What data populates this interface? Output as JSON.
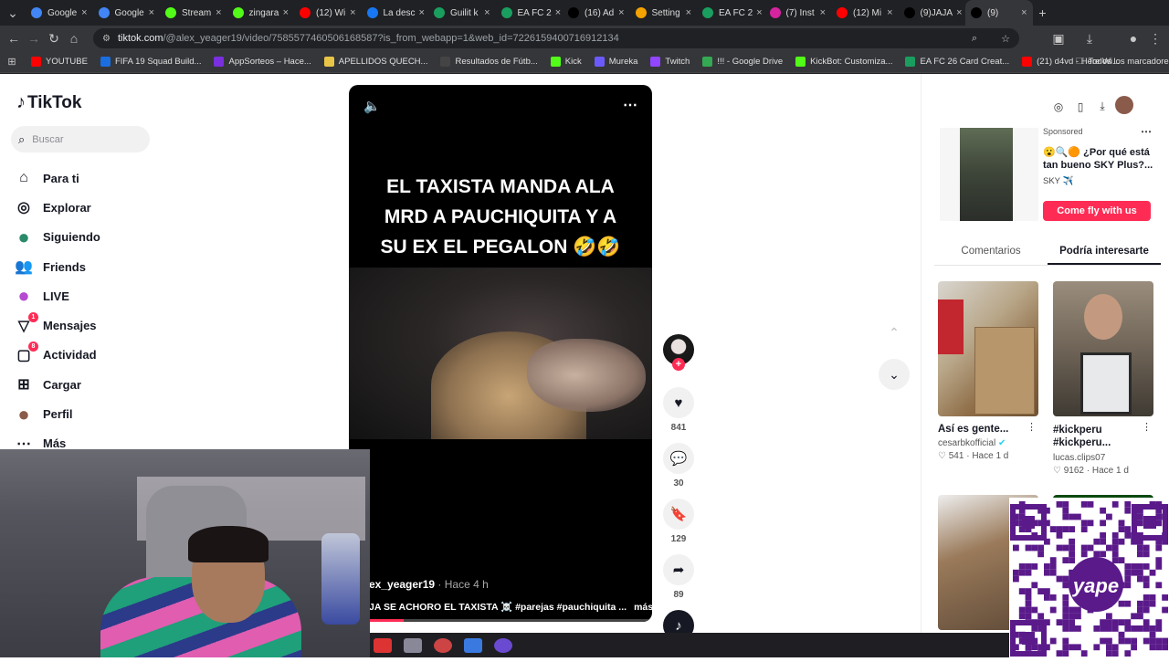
{
  "browser": {
    "tabs": [
      {
        "label": "Google",
        "color": "#4285f4"
      },
      {
        "label": "Google",
        "color": "#4285f4"
      },
      {
        "label": "Stream",
        "color": "#53fc18"
      },
      {
        "label": "zingara",
        "color": "#53fc18"
      },
      {
        "label": "(12) Wi",
        "color": "#ff0000"
      },
      {
        "label": "La desc",
        "color": "#1877f2"
      },
      {
        "label": "Guilit k",
        "color": "#1a9e5f"
      },
      {
        "label": "EA FC 2",
        "color": "#1a9e5f"
      },
      {
        "label": "(16) Ad",
        "color": "#000000"
      },
      {
        "label": "Setting",
        "color": "#f4a300"
      },
      {
        "label": "EA FC 2",
        "color": "#1a9e5f"
      },
      {
        "label": "(7) Inst",
        "color": "#d6249f"
      },
      {
        "label": "(12) Mi",
        "color": "#ff0000"
      },
      {
        "label": "(9)JAJA",
        "color": "#000000"
      },
      {
        "label": "(9) ",
        "color": "#000000"
      }
    ],
    "url_host": "tiktok.com",
    "url_path": "/@alex_yeager19/video/7585577460506168587?is_from_webapp=1&web_id=7226159400716912134",
    "bookmarks": [
      {
        "label": "YOUTUBE",
        "color": "#ff0000"
      },
      {
        "label": "FIFA 19 Squad Build...",
        "color": "#1a6ee0"
      },
      {
        "label": "AppSorteos – Hace...",
        "color": "#7a2fe0"
      },
      {
        "label": "APELLIDOS QUECH...",
        "color": "#e8c547"
      },
      {
        "label": "Resultados de Fútb...",
        "color": "#444444"
      },
      {
        "label": "Kick",
        "color": "#53fc18"
      },
      {
        "label": "Mureka",
        "color": "#6b5bff"
      },
      {
        "label": "Twitch",
        "color": "#9146ff"
      },
      {
        "label": "!!! - Google Drive",
        "color": "#34a853"
      },
      {
        "label": "KickBot: Customiza...",
        "color": "#53fc18"
      },
      {
        "label": "EA FC 26 Card Creat...",
        "color": "#1a9e5f"
      },
      {
        "label": "(21) d4vd - Here Wi...",
        "color": "#ff0000"
      }
    ],
    "all_bookmarks": "Todos los marcadores"
  },
  "sidebar": {
    "logo": "TikTok",
    "search_placeholder": "Buscar",
    "items": [
      {
        "label": "Para ti",
        "icon": "home-icon"
      },
      {
        "label": "Explorar",
        "icon": "compass-icon"
      },
      {
        "label": "Siguiendo",
        "icon": "following-avatar-icon"
      },
      {
        "label": "Friends",
        "icon": "friends-icon"
      },
      {
        "label": "LIVE",
        "icon": "live-avatar-icon"
      },
      {
        "label": "Mensajes",
        "icon": "messages-icon",
        "badge": "1"
      },
      {
        "label": "Actividad",
        "icon": "activity-icon",
        "badge": "8"
      },
      {
        "label": "Cargar",
        "icon": "upload-icon"
      },
      {
        "label": "Perfil",
        "icon": "profile-avatar-icon"
      },
      {
        "label": "Más",
        "icon": "more-icon"
      }
    ]
  },
  "video": {
    "title_line1": "EL TAXISTA MANDA ALA",
    "title_line2": "MRD A PAUCHIQUITA Y A",
    "title_line3": "SU EX EL PEGALON 🤣🤣",
    "username": "ex_yeager19",
    "time": "· Hace 4 h",
    "caption": "JA SE ACHORO EL TAXISTA ☠️ #parejas #pauchiquita ...",
    "more": "más"
  },
  "actions": {
    "likes": "841",
    "comments": "30",
    "saves": "129",
    "shares": "89"
  },
  "right_panel": {
    "sponsored": "Sponsored",
    "ad_title": "😮🔍🟠 ¿Por qué está tan bueno SKY Plus?...",
    "ad_brand": "SKY ✈️",
    "ad_button": "Come fly with us",
    "tab_comments": "Comentarios",
    "tab_suggested": "Podría interesarte",
    "cards": [
      {
        "title": "Así es gente...",
        "user": "cesarbkofficial",
        "likes": "541",
        "time": "Hace 1 d"
      },
      {
        "title": "#kickperu #kickperu...",
        "user": "lucas.clips07",
        "likes": "9162",
        "time": "Hace 1 d"
      }
    ]
  }
}
